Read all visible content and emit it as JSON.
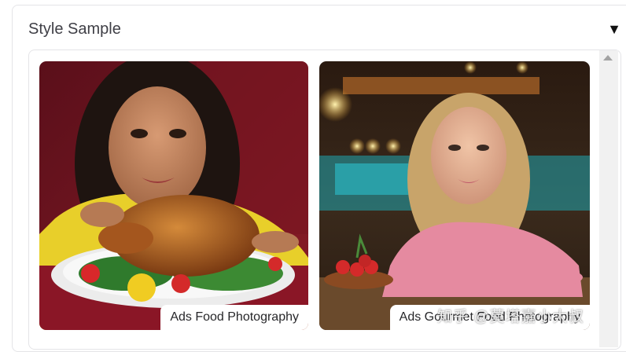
{
  "panel": {
    "title": "Style Sample",
    "toggle_icon": "triangle-down-icon"
  },
  "gallery": {
    "items": [
      {
        "caption": "Ads Food Photography",
        "image": "woman-with-roast-turkey-photo"
      },
      {
        "caption": "Ads Gourmet Food Photography",
        "image": "woman-with-tomatoes-photo"
      }
    ]
  },
  "watermark": "知乎 @莫塔嘉小大叔",
  "colors": {
    "border": "#e4e4e7",
    "text": "#3f3f46",
    "scrollbar": "#f1f1f1"
  }
}
